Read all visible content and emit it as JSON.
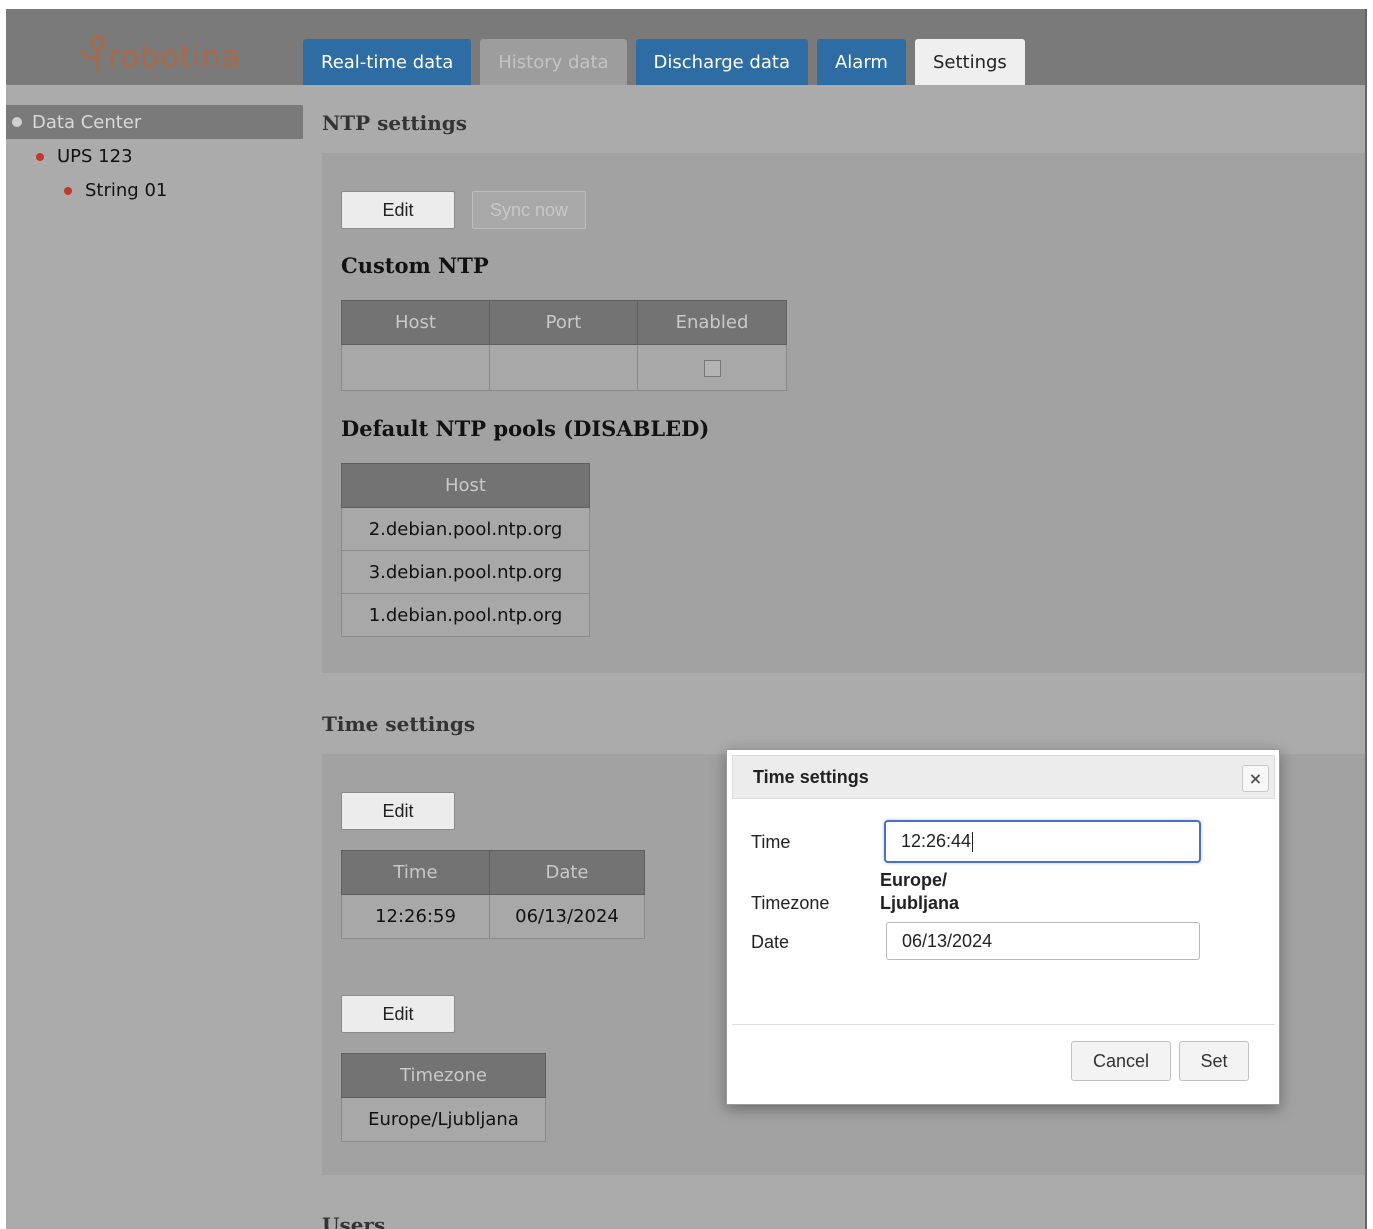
{
  "brand": {
    "logo_text": "robotina",
    "logo_color": "#a86a4a"
  },
  "tabs": [
    {
      "label": "Real-time data",
      "state": "normal"
    },
    {
      "label": "History data",
      "state": "disabled"
    },
    {
      "label": "Discharge data",
      "state": "normal"
    },
    {
      "label": "Alarm",
      "state": "normal"
    },
    {
      "label": "Settings",
      "state": "active"
    }
  ],
  "sidebar": {
    "root": "Data Center",
    "items": [
      {
        "label": "UPS 123"
      },
      {
        "label": "String 01"
      }
    ]
  },
  "ntp": {
    "title": "NTP settings",
    "edit_label": "Edit",
    "sync_label": "Sync now",
    "custom_title": "Custom NTP",
    "custom_headers": [
      "Host",
      "Port",
      "Enabled"
    ],
    "custom_row": {
      "host": "",
      "port": "",
      "enabled": false
    },
    "default_title": "Default NTP pools (DISABLED)",
    "default_header": "Host",
    "default_hosts": [
      "2.debian.pool.ntp.org",
      "3.debian.pool.ntp.org",
      "1.debian.pool.ntp.org"
    ]
  },
  "time": {
    "title": "Time settings",
    "edit_label": "Edit",
    "headers": [
      "Time",
      "Date"
    ],
    "time_value": "12:26:59",
    "date_value": "06/13/2024",
    "tz_edit_label": "Edit",
    "tz_header": "Timezone",
    "tz_value": "Europe/Ljubljana"
  },
  "users": {
    "title": "Users"
  },
  "modal": {
    "title": "Time settings",
    "close_icon": "×",
    "time_label": "Time",
    "time_value": "12:26:44",
    "timezone_label": "Timezone",
    "timezone_line1": "Europe/",
    "timezone_line2": "Ljubljana",
    "date_label": "Date",
    "date_value": "06/13/2024",
    "cancel_label": "Cancel",
    "set_label": "Set"
  },
  "colors": {
    "tab_blue": "#2e6da4",
    "header_grey": "#7a7a7a",
    "content_grey": "#ababab",
    "status_red": "#c0392b",
    "focus_blue": "#4a70c9"
  }
}
